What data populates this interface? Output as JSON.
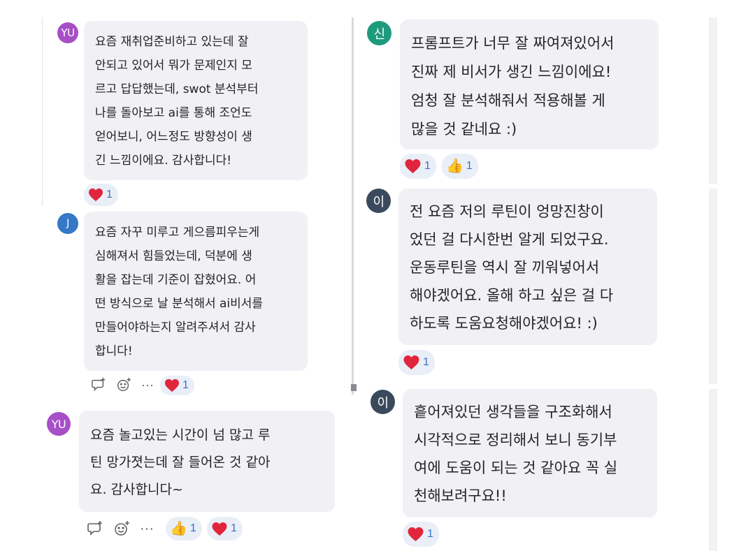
{
  "comments": [
    {
      "initials": "YU",
      "text": "요즘 재취업준비하고 있는데 잘\n안되고 있어서 뭐가 문제인지 모\n르고 답답했는데, swot 분석부터\n나를 돌아보고 ai를 통해 조언도\n얻어보니, 어느정도 방향성이 생\n긴 느낌이에요. 감사합니다!",
      "reactions": [
        {
          "count": "1"
        }
      ]
    },
    {
      "initials": "J",
      "text": "요즘 자꾸 미루고 게으름피우는게\n심해져서 힘들었는데, 덕분에 생\n활을 잡는데 기준이 잡혔어요. 어\n떤 방식으로 날 분석해서 ai비서를\n만들어야하는지 알려주셔서 감사\n합니다!",
      "reactions": [
        {
          "count": "1"
        }
      ]
    },
    {
      "initials": "YU",
      "text": "요즘 놀고있는 시간이 넘 많고 루\n틴 망가졋는데 잘 들어온 것 같아\n요. 감사합니다~",
      "reactions": [
        {
          "count": "1"
        },
        {
          "count": "1"
        }
      ]
    },
    {
      "initials": "신",
      "text": "프롬프트가 너무 잘 짜여져있어서\n진짜 제 비서가 생긴 느낌이에요!\n엄청 잘 분석해줘서 적용해볼 게\n많을 것 같네요 :)",
      "reactions": [
        {
          "count": "1"
        },
        {
          "count": "1"
        }
      ]
    },
    {
      "initials": "이",
      "text": "전 요즘 저의 루틴이 엉망진창이\n었던 걸 다시한번 알게 되었구요.\n운동루틴을 역시 잘 끼워넣어서\n해야겠어요. 올해 하고 싶은 걸 다\n하도록 도움요청해야겠어요! :)",
      "reactions": [
        {
          "count": "1"
        }
      ]
    },
    {
      "initials": "이",
      "text": "흩어져있던 생각들을 구조화해서\n시각적으로 정리해서 보니 동기부\n여에 도움이 되는 것 같아요 꼭 실\n천해보려구요!!",
      "reactions": [
        {
          "count": "1"
        }
      ]
    }
  ],
  "toolbar": {
    "more_label": "···"
  },
  "colors": {
    "yu": "#a64fc7",
    "j": "#3578c6",
    "shin": "#1e9b7c",
    "lee": "#3a4a5c",
    "heart": "#e0263d",
    "accent": "#3d6fd0"
  },
  "icons": [
    "reply-icon",
    "emoji-add-icon",
    "more-icon",
    "heart-icon",
    "thumbs-up-icon"
  ]
}
